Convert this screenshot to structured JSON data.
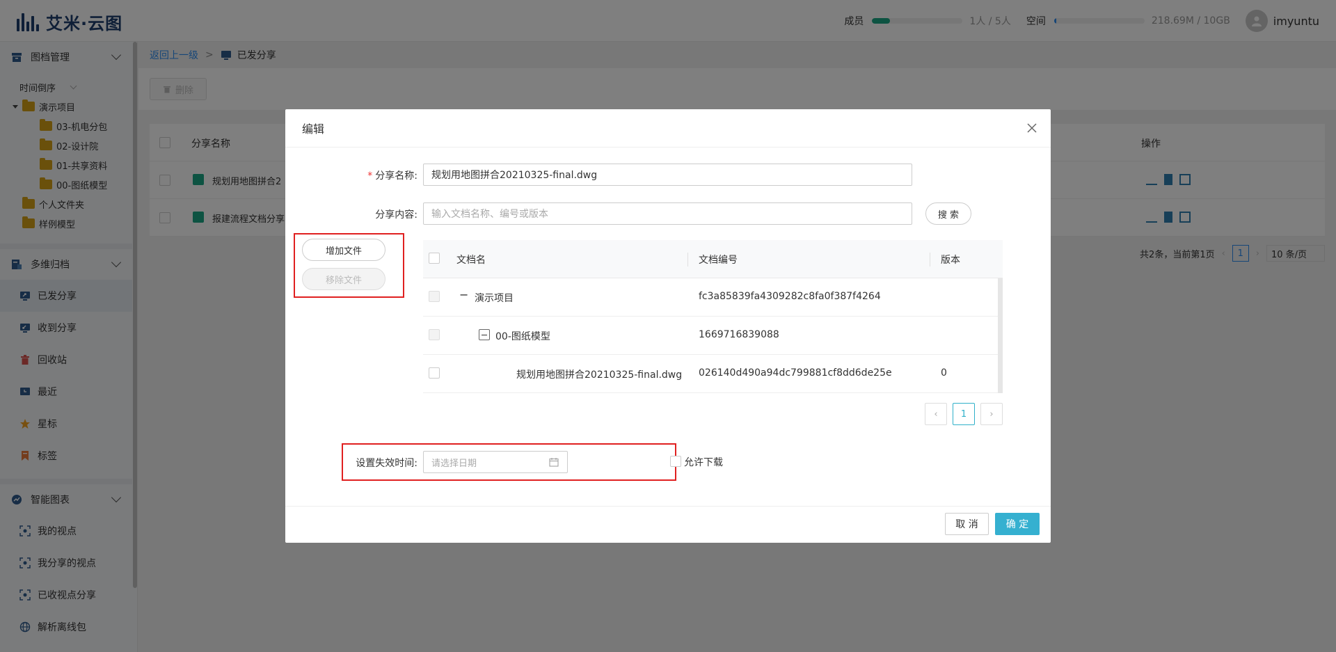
{
  "header": {
    "logo_text": "艾米·云图",
    "members_label": "成员",
    "members_value": "1人 / 5人",
    "members_fill_fraction": 0.2,
    "space_label": "空间",
    "space_value": "218.69M / 10GB",
    "space_fill_fraction": 0.021,
    "user_name": "imyuntu"
  },
  "sidebar": {
    "section1": "图档管理",
    "sort_label": "时间倒序",
    "tree_root": "演示项目",
    "tree_children": [
      "03-机电分包",
      "02-设计院",
      "01-共享资料",
      "00-图纸模型"
    ],
    "personal_folder": "个人文件夹",
    "sample_model": "样例模型",
    "section2": "多维归档",
    "items2": [
      "已发分享",
      "收到分享",
      "回收站",
      "最近",
      "星标",
      "标签"
    ],
    "section3": "智能图表",
    "items3": [
      "我的视点",
      "我分享的视点",
      "已收视点分享",
      "解析离线包"
    ]
  },
  "main": {
    "breadcrumb_back": "返回上一级",
    "breadcrumb_sep": ">",
    "breadcrumb_current": "已发分享",
    "delete_label": "删除",
    "col_name": "分享名称",
    "col_ops": "操作",
    "rows": [
      "规划用地图拼合2",
      "报建流程文档分享"
    ],
    "pager_text": "共2条，当前第1页",
    "pager_page": "1",
    "pager_size": "10 条/页"
  },
  "modal": {
    "title": "编辑",
    "share_name_label": "分享名称:",
    "share_name_value": "规划用地图拼合20210325-final.dwg",
    "share_content_label": "分享内容:",
    "search_placeholder": "输入文档名称、编号或版本",
    "search_btn": "搜 索",
    "add_file": "增加文件",
    "remove_file": "移除文件",
    "columns": [
      "文档名",
      "文档编号",
      "版本"
    ],
    "rows": [
      {
        "name": "演示项目",
        "code": "fc3a85839fa4309282c8fa0f387f4264",
        "version": ""
      },
      {
        "name": "00-图纸模型",
        "code": "1669716839088",
        "version": ""
      },
      {
        "name": "规划用地图拼合20210325-final.dwg",
        "code": "026140d490a94dc799881cf8dd6de25e",
        "version": "0"
      }
    ],
    "page": "1",
    "expire_label": "设置失效时间:",
    "date_placeholder": "请选择日期",
    "allow_download": "允许下载",
    "cancel": "取 消",
    "ok": "确 定"
  },
  "colors": {
    "accent": "#35b0d0",
    "link": "#2d8cf0",
    "highlight_box": "#e02020",
    "member_bar": "#1ba784"
  }
}
